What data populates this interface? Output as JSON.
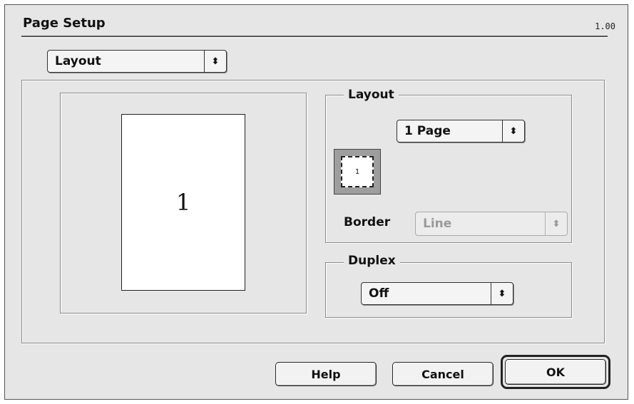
{
  "dialog": {
    "title": "Page Setup",
    "version": "1.00"
  },
  "panel_selector": {
    "selected": "Layout",
    "arrow_glyph": "⬍"
  },
  "preview": {
    "page_number": "1"
  },
  "layout_group": {
    "label": "Layout",
    "pages_per_sheet": "1 Page",
    "thumbnail_number": "1",
    "border_label": "Border",
    "border_value": "Line"
  },
  "duplex_group": {
    "label": "Duplex",
    "value": "Off"
  },
  "buttons": {
    "help": "Help",
    "cancel": "Cancel",
    "ok": "OK"
  },
  "colors": {
    "dialog_background": "#e6e6e6",
    "disabled_text": "#9a9a9a"
  }
}
